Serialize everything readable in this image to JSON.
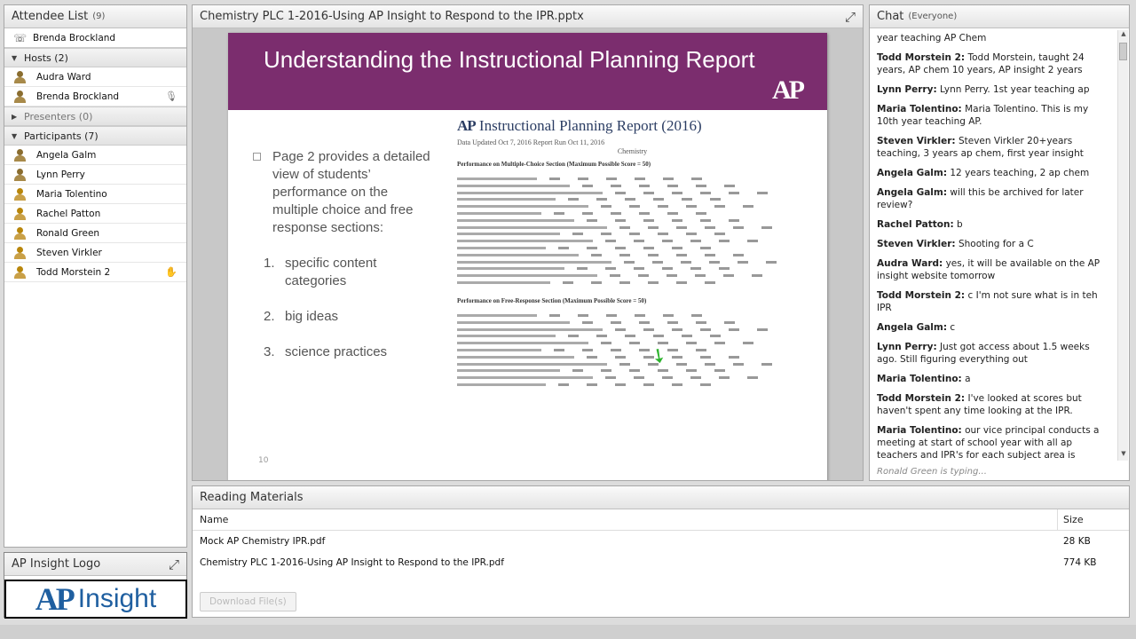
{
  "attendees": {
    "title": "Attendee List",
    "count": "(9)",
    "presenter_line": "Brenda Brockland",
    "hosts_label": "Hosts (2)",
    "hosts": [
      "Audra Ward",
      "Brenda Brockland"
    ],
    "presenters_label": "Presenters (0)",
    "participants_label": "Participants (7)",
    "participants": [
      "Angela Galm",
      "Lynn Perry",
      "Maria Tolentino",
      "Rachel Patton",
      "Ronald Green",
      "Steven Virkler",
      "Todd Morstein 2"
    ]
  },
  "share": {
    "title": "Chemistry PLC 1-2016-Using AP Insight to Respond to the IPR.pptx",
    "slide": {
      "title": "Understanding the Instructional Planning Report",
      "logo": "AP",
      "bullet": "Page 2 provides a detailed view of students’ performance on the multiple choice and free response sections:",
      "list": [
        {
          "n": "1.",
          "text": "specific content categories"
        },
        {
          "n": "2.",
          "text": "big ideas"
        },
        {
          "n": "3.",
          "text": "science practices"
        }
      ],
      "page_num": "10",
      "report_title_ap": "AP",
      "report_title": "Instructional Planning Report (2016)",
      "report_sub": "Data Updated  Oct 7, 2016   Report Run Oct 11, 2016",
      "report_subject": "Chemistry",
      "report_sec1": "Performance on Multiple-Choice Section  (Maximum Possible Score = 50)",
      "report_sec2": "Performance on Free-Response Section  (Maximum Possible Score = 50)"
    }
  },
  "chat": {
    "title": "Chat",
    "scope": "(Everyone)",
    "messages": [
      {
        "who": "",
        "text": "year teaching AP Chem"
      },
      {
        "who": "Todd Morstein 2:",
        "text": "Todd Morstein, taught 24 years, AP chem 10 years, AP insight 2 years"
      },
      {
        "who": "Lynn Perry:",
        "text": "Lynn Perry. 1st year teaching ap"
      },
      {
        "who": "Maria Tolentino:",
        "text": "Maria Tolentino. This is my 10th year teaching AP."
      },
      {
        "who": "Steven Virkler:",
        "text": "Steven Virkler 20+years teaching, 3 years ap chem, first year insight"
      },
      {
        "who": "Angela Galm:",
        "text": "12 years teaching, 2 ap chem"
      },
      {
        "who": "Angela Galm:",
        "text": "will this be archived for later review?"
      },
      {
        "who": "Rachel Patton:",
        "text": "b"
      },
      {
        "who": "Steven Virkler:",
        "text": "Shooting for a C"
      },
      {
        "who": "Audra Ward:",
        "text": "yes, it will be available on the AP insight website tomorrow"
      },
      {
        "who": "Todd Morstein 2:",
        "text": "c I'm not sure what is in teh IPR"
      },
      {
        "who": "Angela Galm:",
        "text": "c"
      },
      {
        "who": "Lynn Perry:",
        "text": "Just got access about 1.5 weeks ago. Still figuring everything out"
      },
      {
        "who": "Maria Tolentino:",
        "text": "a"
      },
      {
        "who": "Todd Morstein 2:",
        "text": "I've looked at scores but haven't spent any time looking at the IPR."
      },
      {
        "who": "Maria Tolentino:",
        "text": "our vice principal conducts a meeting at start of school year with all ap teachers and IPR's for each subject area is handed out"
      }
    ],
    "typing": "Ronald Green is typing..."
  },
  "files": {
    "title": "Reading Materials",
    "col_name": "Name",
    "col_size": "Size",
    "rows": [
      {
        "name": "Mock AP Chemistry IPR.pdf",
        "size": "28 KB"
      },
      {
        "name": "Chemistry PLC 1-2016-Using AP Insight to Respond to the IPR.pdf",
        "size": "774 KB"
      }
    ],
    "download_label": "Download File(s)"
  },
  "logo_pod": {
    "title": "AP Insight Logo",
    "ap": "AP",
    "insight": "Insight"
  },
  "icons": {
    "fullscreen": "fullscreen-icon",
    "phone": "phone-icon",
    "person": "person-icon",
    "mic": "microphone-icon",
    "raised_hand": "raised-hand-icon"
  },
  "colors": {
    "slide_header": "#7b2d6e",
    "report_title": "#2b3d63",
    "arrow": "#2cb32c",
    "logo_blue": "#1f5fa0"
  }
}
